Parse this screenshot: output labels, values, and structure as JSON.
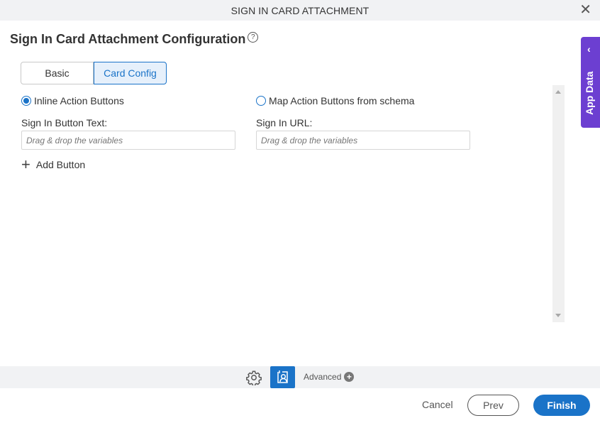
{
  "window": {
    "title": "SIGN IN CARD ATTACHMENT",
    "close_icon": "close-icon"
  },
  "page": {
    "title": "Sign In Card Attachment Configuration",
    "help_icon": "?"
  },
  "tabs": [
    {
      "label": "Basic",
      "active": false
    },
    {
      "label": "Card Config",
      "active": true
    }
  ],
  "options": {
    "inline": {
      "label": "Inline Action Buttons",
      "selected": true
    },
    "map": {
      "label": "Map Action Buttons from schema",
      "selected": false
    }
  },
  "fields": {
    "sign_in_button_text": {
      "label": "Sign In Button Text:",
      "value": "",
      "placeholder": "Drag & drop the variables"
    },
    "sign_in_url": {
      "label": "Sign In URL:",
      "value": "",
      "placeholder": "Drag & drop the variables"
    }
  },
  "add_button": {
    "icon": "+",
    "label": "Add Button"
  },
  "side_panel": {
    "label": "App Data",
    "chevron": "‹"
  },
  "toolbar": {
    "advanced_label": "Advanced",
    "advanced_icon": "+"
  },
  "footer": {
    "cancel": "Cancel",
    "prev": "Prev",
    "finish": "Finish"
  },
  "colors": {
    "accent": "#1a73c8",
    "side_panel": "#6c3fd1",
    "toolbar_bg": "#f1f2f4"
  }
}
